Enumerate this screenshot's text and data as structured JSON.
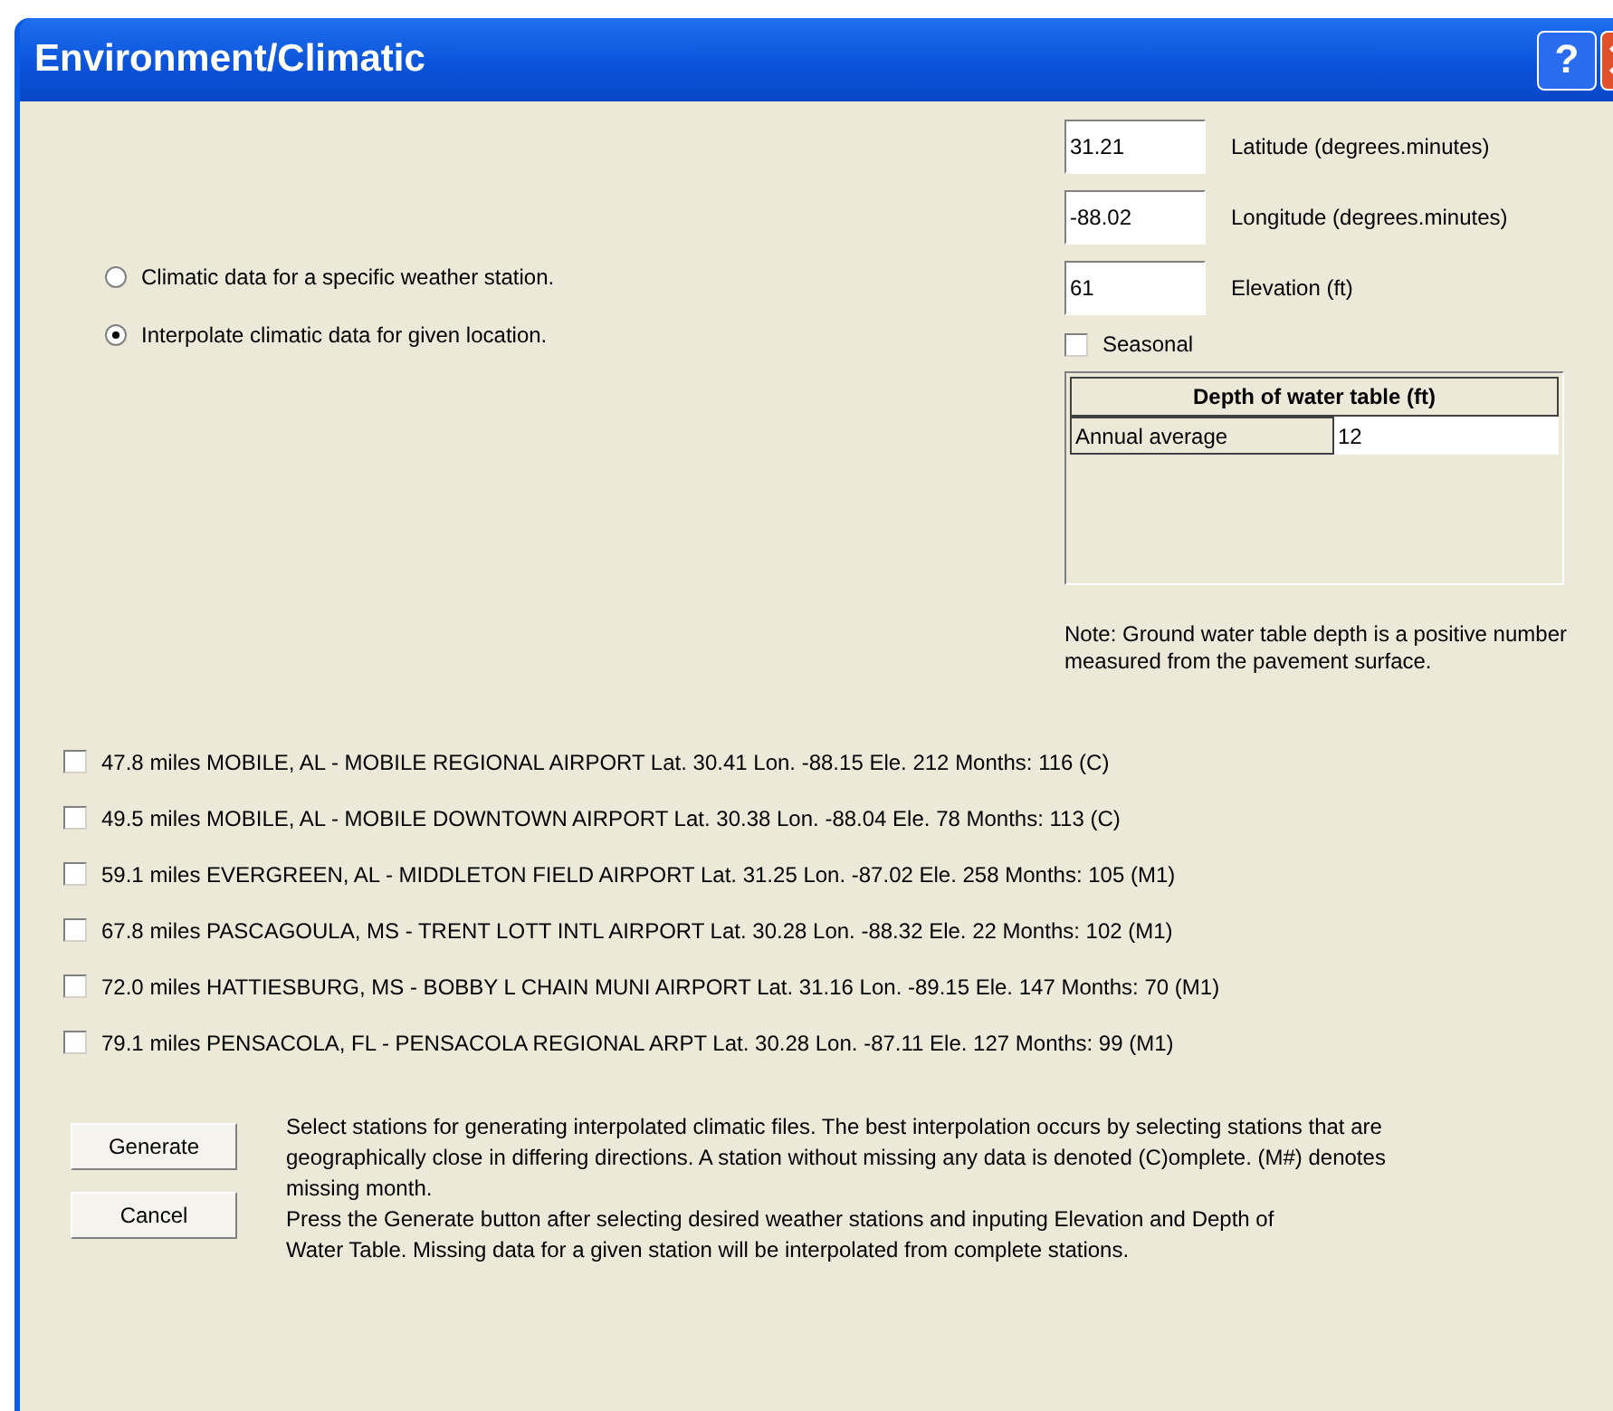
{
  "window": {
    "title": "Environment/Climatic",
    "help_button": "?"
  },
  "location_fields": [
    {
      "value": "31.21",
      "label": "Latitude (degrees.minutes)"
    },
    {
      "value": "-88.02",
      "label": "Longitude (degrees.minutes)"
    },
    {
      "value": "61",
      "label": "Elevation (ft)"
    }
  ],
  "mode_options": [
    {
      "label": "Climatic data for a specific weather station.",
      "selected": false
    },
    {
      "label": "Interpolate climatic data  for given location.",
      "selected": true
    }
  ],
  "seasonal": {
    "label": "Seasonal",
    "checked": false
  },
  "water_table": {
    "header": "Depth of water table (ft)",
    "rows": [
      {
        "label": "Annual average",
        "value": "12"
      }
    ]
  },
  "note": "Note: Ground water table depth is a positive number measured from the pavement surface.",
  "stations": [
    {
      "label": "47.8 miles MOBILE, AL - MOBILE REGIONAL AIRPORT  Lat. 30.41  Lon. -88.15  Ele. 212  Months: 116 (C)",
      "checked": false
    },
    {
      "label": "49.5 miles MOBILE, AL - MOBILE DOWNTOWN AIRPORT  Lat. 30.38  Lon. -88.04  Ele. 78  Months: 113 (C)",
      "checked": false
    },
    {
      "label": "59.1 miles EVERGREEN, AL - MIDDLETON FIELD AIRPORT  Lat. 31.25  Lon. -87.02  Ele. 258  Months: 105 (M1)",
      "checked": false
    },
    {
      "label": "67.8 miles PASCAGOULA, MS - TRENT LOTT INTL AIRPORT  Lat. 30.28  Lon. -88.32  Ele. 22  Months: 102 (M1)",
      "checked": false
    },
    {
      "label": "72.0 miles HATTIESBURG, MS - BOBBY L CHAIN MUNI AIRPORT  Lat. 31.16  Lon. -89.15  Ele. 147  Months: 70 (M1)",
      "checked": false
    },
    {
      "label": "79.1 miles PENSACOLA, FL - PENSACOLA REGIONAL ARPT  Lat. 30.28  Lon. -87.11  Ele. 127  Months: 99 (M1)",
      "checked": false
    }
  ],
  "buttons": [
    "Generate",
    "Cancel"
  ],
  "instructions": [
    "Select stations for generating interpolated climatic files.   The best interpolation occurs by selecting stations that are geographically close in differing directions. A station without missing any data is denoted (C)omplete. (M#) denotes missing month.",
    "Press the Generate button after selecting desired weather stations and inputing Elevation and Depth of Water Table.  Missing data for a given station will be interpolated from complete stations."
  ]
}
